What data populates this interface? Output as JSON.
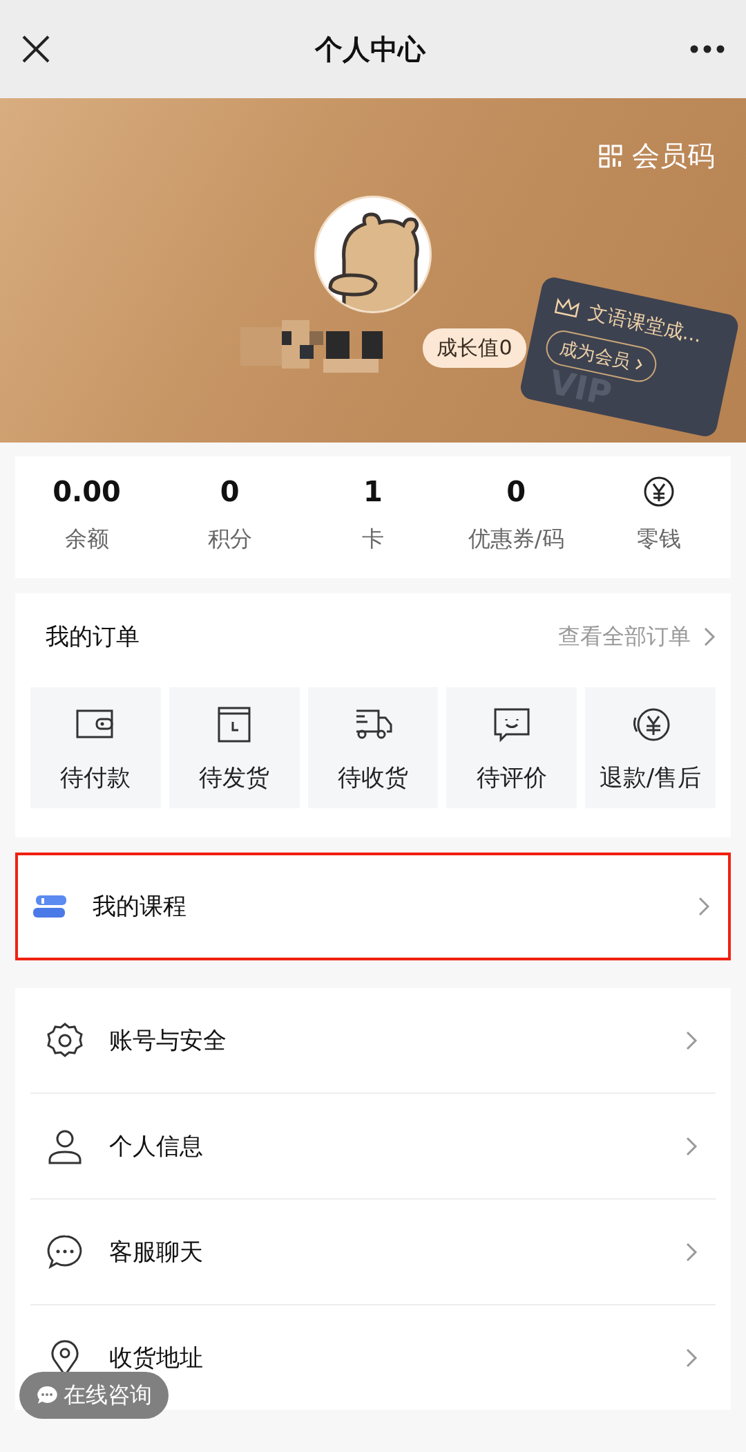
{
  "header": {
    "title": "个人中心"
  },
  "profile": {
    "member_code": "会员码",
    "growth": "成长值0",
    "vip_card": {
      "title": "文语课堂成...",
      "button": "成为会员",
      "mark": "VIP"
    }
  },
  "stats": [
    {
      "kind": "number",
      "value": "0.00",
      "label": "余额"
    },
    {
      "kind": "number",
      "value": "0",
      "label": "积分"
    },
    {
      "kind": "number",
      "value": "1",
      "label": "卡"
    },
    {
      "kind": "number",
      "value": "0",
      "label": "优惠券/码"
    },
    {
      "kind": "icon",
      "label": "零钱"
    }
  ],
  "orders": {
    "title": "我的订单",
    "view_all": "查看全部订单",
    "items": [
      {
        "kind": "wallet",
        "label": "待付款"
      },
      {
        "kind": "clock",
        "label": "待发货"
      },
      {
        "kind": "truck",
        "label": "待收货"
      },
      {
        "kind": "comment",
        "label": "待评价"
      },
      {
        "kind": "refund",
        "label": "退款/售后"
      }
    ]
  },
  "course": {
    "label": "我的课程",
    "highlighted": true
  },
  "menu": [
    {
      "kind": "gear",
      "label": "账号与安全"
    },
    {
      "kind": "user",
      "label": "个人信息"
    },
    {
      "kind": "chat",
      "label": "客服聊天"
    },
    {
      "kind": "pin",
      "label": "收货地址"
    }
  ],
  "chat_button": "在线咨询"
}
